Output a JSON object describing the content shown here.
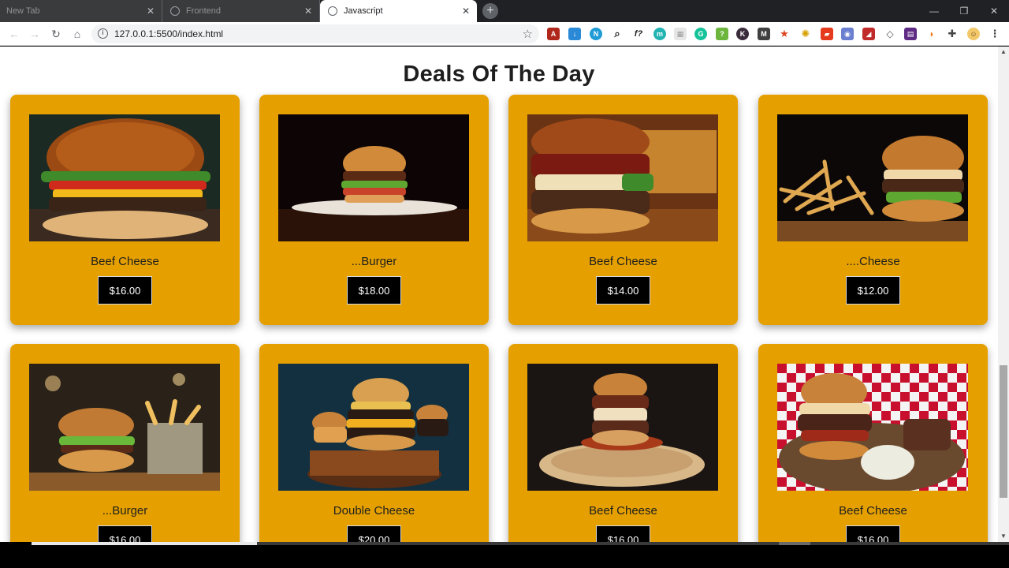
{
  "browser": {
    "tabs": [
      {
        "title": "New Tab",
        "active": false
      },
      {
        "title": "Frontend",
        "active": false
      },
      {
        "title": "Javascript",
        "active": true
      }
    ],
    "url": "127.0.0.1:5500/index.html"
  },
  "page": {
    "section_title": "Deals Of The Day",
    "products": [
      {
        "name": "Beef Cheese",
        "price": "$16.00"
      },
      {
        "name": "...Burger",
        "price": "$18.00"
      },
      {
        "name": "Beef Cheese",
        "price": "$14.00"
      },
      {
        "name": "....Cheese",
        "price": "$12.00"
      },
      {
        "name": "...Burger",
        "price": "$16.00"
      },
      {
        "name": "Double Cheese",
        "price": "$20.00"
      },
      {
        "name": "Beef Cheese",
        "price": "$16.00"
      },
      {
        "name": "Beef Cheese",
        "price": "$16.00"
      }
    ]
  },
  "colors": {
    "card_background": "#e5a000",
    "price_background": "#000000",
    "title_text": "#1e1e1e"
  }
}
